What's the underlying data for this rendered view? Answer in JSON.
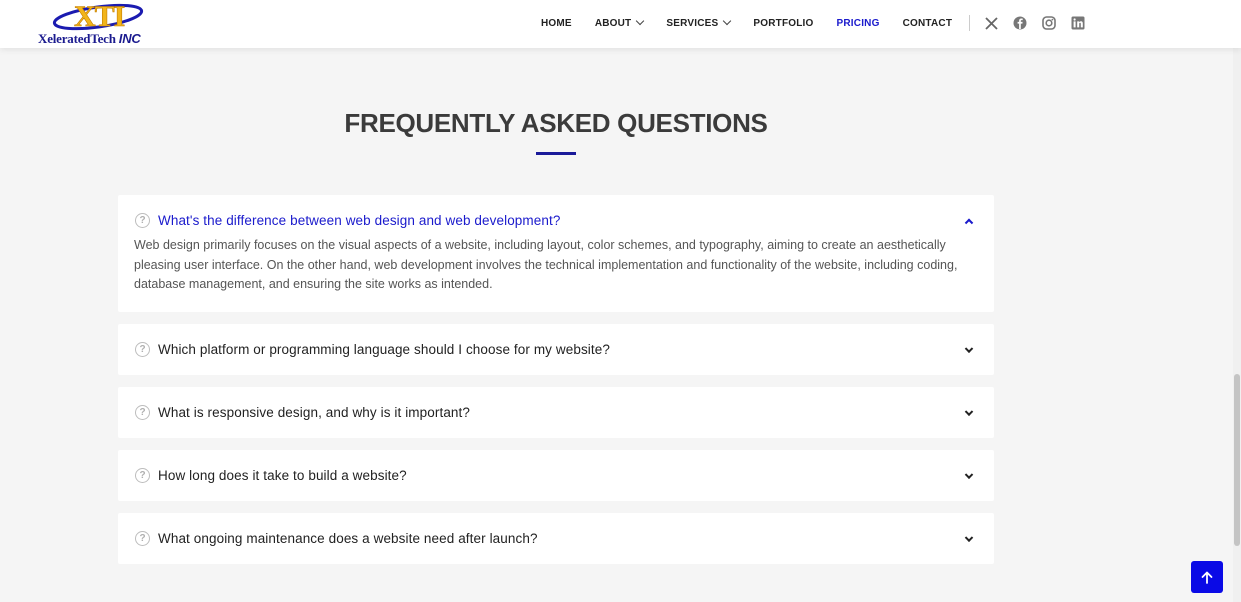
{
  "brand": {
    "logo_mark": "XTI",
    "name": "XeleratedTech",
    "suffix": "INC"
  },
  "nav": {
    "items": [
      {
        "label": "HOME",
        "dropdown": false,
        "active": false
      },
      {
        "label": "ABOUT",
        "dropdown": true,
        "active": false
      },
      {
        "label": "SERVICES",
        "dropdown": true,
        "active": false
      },
      {
        "label": "PORTFOLIO",
        "dropdown": false,
        "active": false
      },
      {
        "label": "PRICING",
        "dropdown": false,
        "active": true
      },
      {
        "label": "CONTACT",
        "dropdown": false,
        "active": false
      }
    ],
    "social": [
      "x-icon",
      "facebook-icon",
      "instagram-icon",
      "linkedin-icon"
    ]
  },
  "faq": {
    "title": "FREQUENTLY ASKED QUESTIONS",
    "items": [
      {
        "question": "What's the difference between web design and web development?",
        "answer": "Web design primarily focuses on the visual aspects of a website, including layout, color schemes, and typography, aiming to create an aesthetically pleasing user interface. On the other hand, web development involves the technical implementation and functionality of the website, including coding, database management, and ensuring the site works as intended.",
        "expanded": true
      },
      {
        "question": "Which platform or programming language should I choose for my website?",
        "expanded": false
      },
      {
        "question": "What is responsive design, and why is it important?",
        "expanded": false
      },
      {
        "question": "How long does it take to build a website?",
        "expanded": false
      },
      {
        "question": "What ongoing maintenance does a website need after launch?",
        "expanded": false
      }
    ]
  },
  "colors": {
    "accent": "#1a1acc",
    "back_to_top": "#0a0ae6",
    "title": "#3b3b3b",
    "background": "#f5f5f5"
  }
}
